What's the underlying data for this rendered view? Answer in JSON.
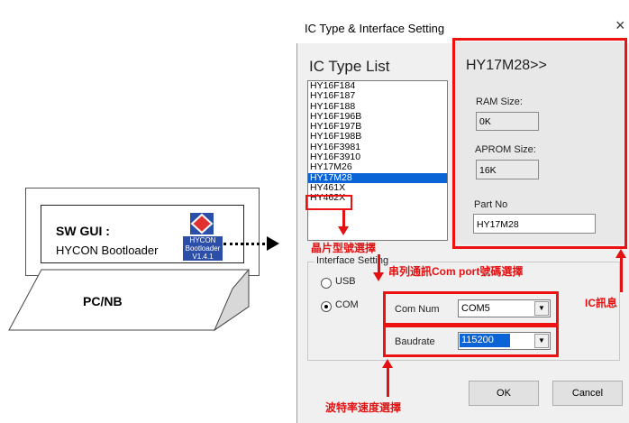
{
  "left_panel": {
    "gui_title": "SW GUI :",
    "gui_subtitle": "HYCON Bootloader",
    "app_icon_lines": [
      "HYCON",
      "Bootloader",
      "V1.4.1"
    ],
    "device_label": "PC/NB"
  },
  "dialog": {
    "title": "IC Type & Interface Setting",
    "close_glyph": "×",
    "list_heading": "IC Type List",
    "ic_list": [
      "HY16F184",
      "HY16F187",
      "HY16F188",
      "HY16F196B",
      "HY16F197B",
      "HY16F198B",
      "HY16F3981",
      "HY16F3910",
      "HY17M26",
      "HY17M28",
      "HY461X",
      "HY462X"
    ],
    "selected_ic": "HY17M28",
    "info": {
      "heading": "HY17M28>>",
      "ram_label": "RAM Size:",
      "ram_value": "0K",
      "aprom_label": "APROM Size:",
      "aprom_value": "16K",
      "partno_label": "Part No",
      "partno_value": "HY17M28"
    },
    "interface": {
      "legend": "Interface Setting",
      "usb_label": "USB",
      "com_label": "COM",
      "selected": "COM",
      "comnum_label": "Com Num",
      "comnum_value": "COM5",
      "baud_label": "Baudrate",
      "baud_value": "115200"
    },
    "ok_label": "OK",
    "cancel_label": "Cancel"
  },
  "annotations": {
    "chip_select": "晶片型號選擇",
    "com_select": "串列通訊Com port號碼選擇",
    "ic_info": "IC訊息",
    "baud_select": "波特率速度選擇"
  },
  "colors": {
    "annotation_red": "#e31111",
    "selection_blue": "#0a64d6"
  }
}
